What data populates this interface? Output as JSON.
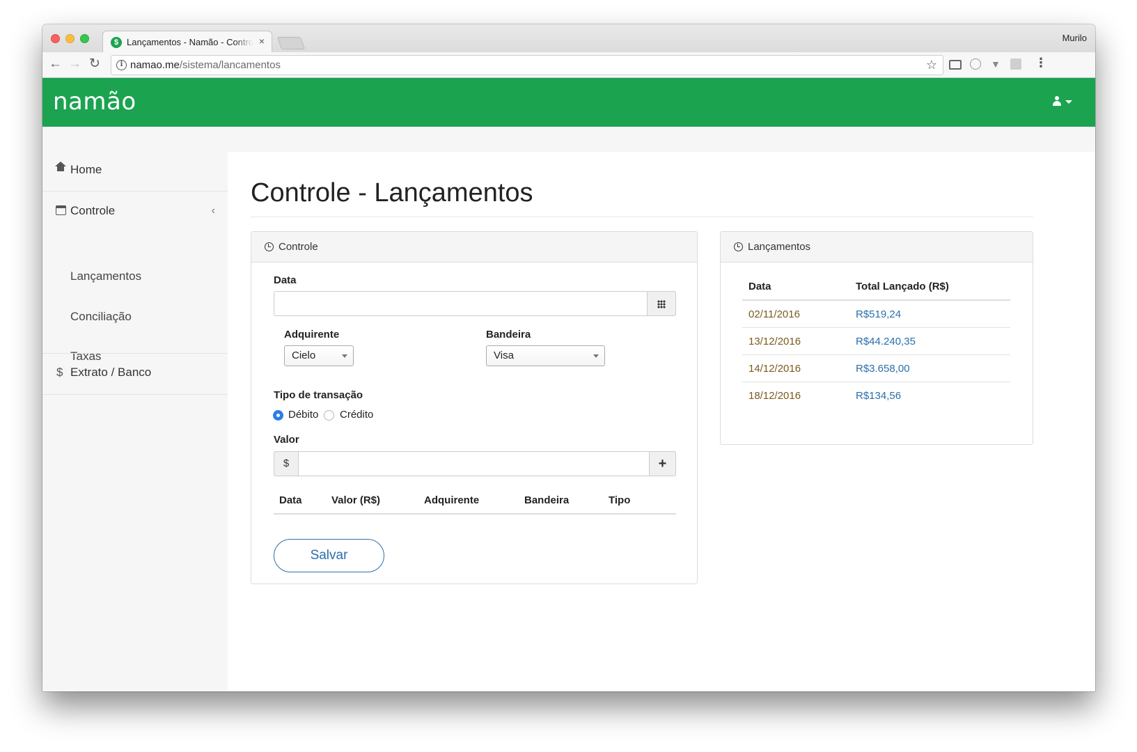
{
  "browser": {
    "tab_title": "Lançamentos - Namão - Controle",
    "tab_close": "×",
    "profile_name": "Murilo",
    "url_host": "namao.me",
    "url_path": "/sistema/lancamentos",
    "nav_back": "←",
    "nav_forward": "→",
    "nav_reload": "↻",
    "star": "☆",
    "favicon": "$",
    "ext_vee": "▼",
    "menu": "⋮"
  },
  "header": {
    "logo": "namão",
    "bg_color": "#1ba350"
  },
  "sidebar": {
    "items": [
      {
        "label": "Home",
        "icon": "home-icon"
      },
      {
        "label": "Controle",
        "icon": "calendar-icon",
        "chevron": "‹"
      },
      {
        "label": "Lançamentos"
      },
      {
        "label": "Conciliação"
      },
      {
        "label": "Taxas"
      },
      {
        "label": "Extrato / Banco",
        "icon": "dollar-icon",
        "icon_glyph": "$"
      }
    ]
  },
  "main": {
    "title": "Controle - Lançamentos",
    "form_panel": {
      "title": "Controle",
      "data_label": "Data",
      "data_value": "",
      "adquirente_label": "Adquirente",
      "adquirente_value": "Cielo",
      "bandeira_label": "Bandeira",
      "bandeira_value": "Visa",
      "tipo_label": "Tipo de transação",
      "radio_debito": "Débito",
      "radio_credito": "Crédito",
      "tipo_selected": "Débito",
      "valor_label": "Valor",
      "valor_prefix": "$",
      "valor_value": "",
      "add_glyph": "+",
      "table_headers": [
        "Data",
        "Valor (R$)",
        "Adquirente",
        "Bandeira",
        "Tipo"
      ],
      "save_label": "Salvar"
    },
    "list_panel": {
      "title": "Lançamentos",
      "headers": [
        "Data",
        "Total Lançado (R$)"
      ],
      "rows": [
        {
          "date": "02/11/2016",
          "total": "R$519,24"
        },
        {
          "date": "13/12/2016",
          "total": "R$44.240,35"
        },
        {
          "date": "14/12/2016",
          "total": "R$3.658,00"
        },
        {
          "date": "18/12/2016",
          "total": "R$134,56"
        }
      ],
      "date_color": "#7b5a1e",
      "value_color": "#2a6fab"
    }
  }
}
